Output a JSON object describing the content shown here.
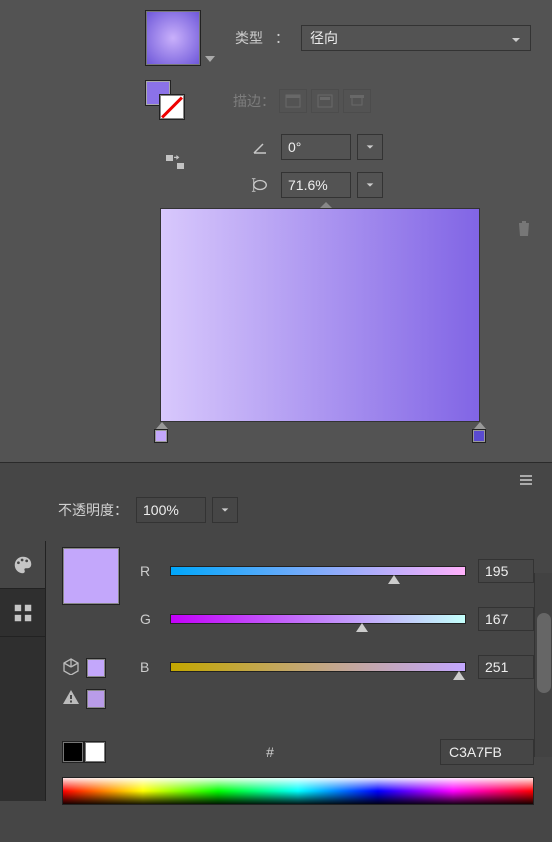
{
  "gradient": {
    "type_label": "类型",
    "type_value": "径向",
    "stroke_label": "描边",
    "angle_value": "0°",
    "aspect_value": "71.6%"
  },
  "opacity": {
    "label": "不透明度",
    "value": "100%"
  },
  "color": {
    "r_label": "R",
    "g_label": "B",
    "r_value": "195",
    "g_value": "167",
    "b_value": "251",
    "r_chan": "R",
    "g_chan": "G",
    "b_chan": "B",
    "hex": "C3A7FB",
    "hash": "#"
  }
}
